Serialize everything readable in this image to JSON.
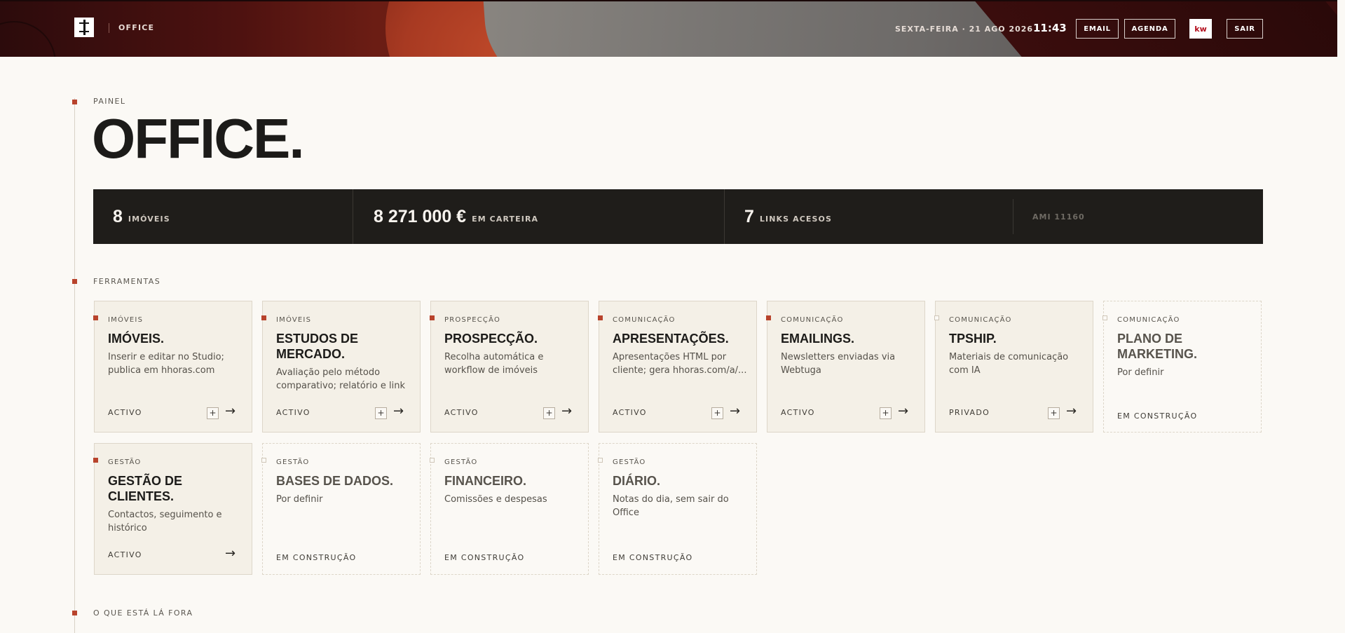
{
  "header": {
    "brand": "OFFICE",
    "date": "SEXTA-FEIRA · 21 AGO 2026",
    "time": "11:43",
    "buttons": {
      "email": "EMAIL",
      "agenda": "AGENDA",
      "sair": "SAIR"
    },
    "kw_badge": "kw",
    "colors": {
      "header_bg": "#4e1210",
      "accent": "#b8432c",
      "kw_red": "#b40f1e"
    }
  },
  "painel": {
    "section_label": "PAINEL",
    "title": "OFFICE."
  },
  "stats": [
    {
      "value": "8",
      "label": "IMÓVEIS"
    },
    {
      "value": "8 271 000 €",
      "label": "EM CARTEIRA"
    },
    {
      "value": "7",
      "label": "LINKS ACESOS"
    }
  ],
  "ami": "AMI 11160",
  "ferramentas": {
    "section_label": "FERRAMENTAS",
    "cards": [
      {
        "category": "IMÓVEIS",
        "title": "IMÓVEIS.",
        "description": "Inserir e editar no Studio; publica em hhoras.com",
        "status": "ACTIVO",
        "plus": "+",
        "arrow": "→"
      },
      {
        "category": "IMÓVEIS",
        "title": "ESTUDOS DE MERCADO.",
        "description": "Avaliação pelo método comparativo; relatório e link",
        "status": "ACTIVO",
        "plus": "+",
        "arrow": "→"
      },
      {
        "category": "PROSPECÇÃO",
        "title": "PROSPECÇÃO.",
        "description": "Recolha automática e workflow de imóveis",
        "status": "ACTIVO",
        "plus": "+",
        "arrow": "→"
      },
      {
        "category": "COMUNICAÇÃO",
        "title": "APRESENTAÇÕES.",
        "description": "Apresentações HTML por cliente; gera hhoras.com/a/...",
        "status": "ACTIVO",
        "plus": "+",
        "arrow": "→"
      },
      {
        "category": "COMUNICAÇÃO",
        "title": "EMAILINGS.",
        "description": "Newsletters enviadas via Webtuga",
        "status": "ACTIVO",
        "plus": "+",
        "arrow": "→"
      },
      {
        "category": "COMUNICAÇÃO",
        "title": "TPSHIP.",
        "description": "Materiais de comunicação com IA",
        "status": "PRIVADO",
        "plus": "+",
        "arrow": "→"
      },
      {
        "category": "COMUNICAÇÃO",
        "title": "PLANO DE MARKETING.",
        "description": "Por definir",
        "status": "EM CONSTRUÇÃO"
      },
      {
        "category": "GESTÃO",
        "title": "GESTÃO DE CLIENTES.",
        "description": "Contactos, seguimento e histórico",
        "status": "ACTIVO",
        "arrow": "→"
      },
      {
        "category": "GESTÃO",
        "title": "BASES DE DADOS.",
        "description": "Por definir",
        "status": "EM CONSTRUÇÃO"
      },
      {
        "category": "GESTÃO",
        "title": "FINANCEIRO.",
        "description": "Comissões e despesas",
        "status": "EM CONSTRUÇÃO"
      },
      {
        "category": "GESTÃO",
        "title": "DIÁRIO.",
        "description": "Notas do dia, sem sair do Office",
        "status": "EM CONSTRUÇÃO"
      }
    ]
  },
  "outside": {
    "section_label": "O QUE ESTÁ LÁ FORA"
  }
}
